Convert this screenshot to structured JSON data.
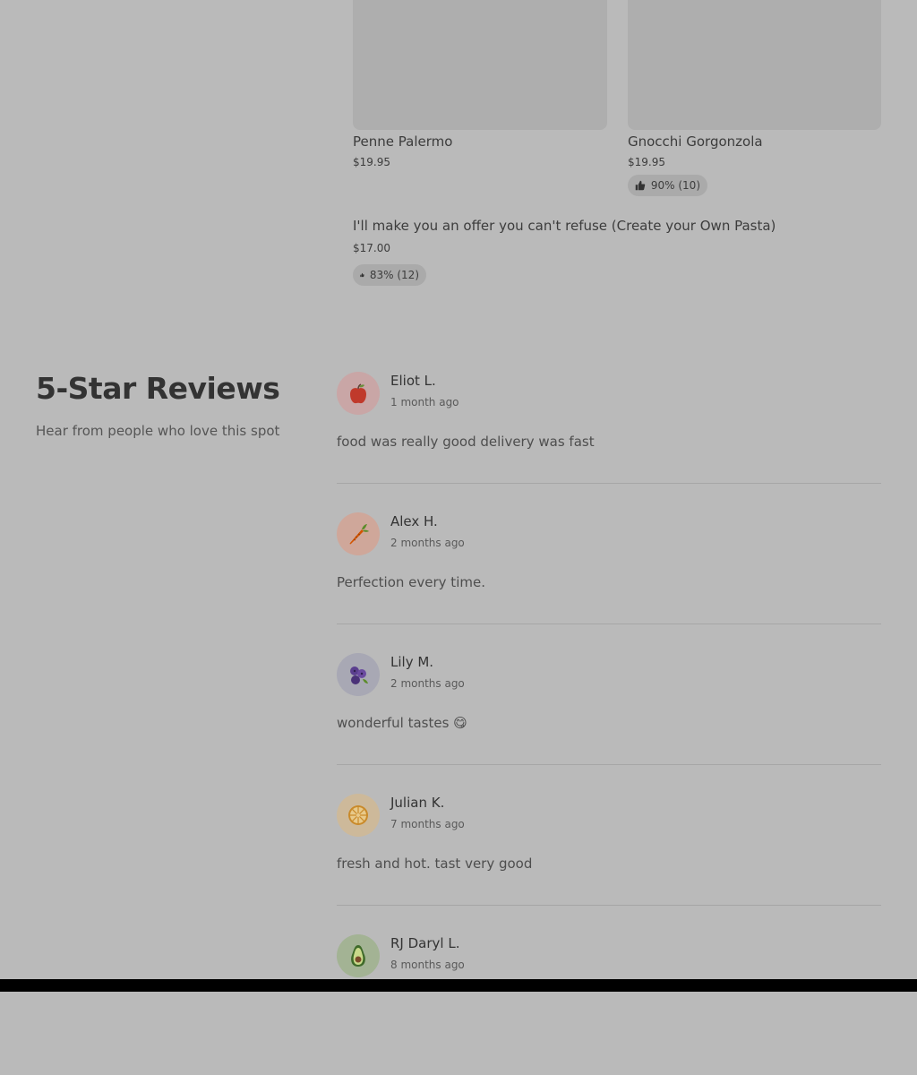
{
  "menu": {
    "items": [
      {
        "name": "Penne Palermo",
        "price": "$19.95"
      },
      {
        "name": "Gnocchi Gorgonzola",
        "price": "$19.95",
        "rating": "90% (10)"
      },
      {
        "name": "I'll make you an offer you can't refuse (Create your Own Pasta)",
        "price": "$17.00",
        "rating": "83% (12)"
      }
    ]
  },
  "reviews_section": {
    "title": "5-Star Reviews",
    "subtitle": "Hear from people who love this spot",
    "reviews": [
      {
        "name": "Eliot L.",
        "time": "1 month ago",
        "text": "food was really good delivery was fast",
        "avatar_icon": "apple-icon",
        "avatar_bg": "#c9a6a6"
      },
      {
        "name": "Alex H.",
        "time": "2 months ago",
        "text": "Perfection every time.",
        "avatar_icon": "carrot-icon",
        "avatar_bg": "#cfa79a"
      },
      {
        "name": "Lily M.",
        "time": "2 months ago",
        "text": "wonderful tastes 😋",
        "avatar_icon": "blueberries-icon",
        "avatar_bg": "#a8a8b4"
      },
      {
        "name": "Julian K.",
        "time": "7 months ago",
        "text": "fresh and hot. tast very good",
        "avatar_icon": "orange-slice-icon",
        "avatar_bg": "#cdb99a"
      },
      {
        "name": "RJ Daryl L.",
        "time": "8 months ago",
        "text": "",
        "avatar_icon": "avocado-icon",
        "avatar_bg": "#a3b394"
      }
    ]
  },
  "icons": {
    "rating": "thumbs-up-icon"
  }
}
